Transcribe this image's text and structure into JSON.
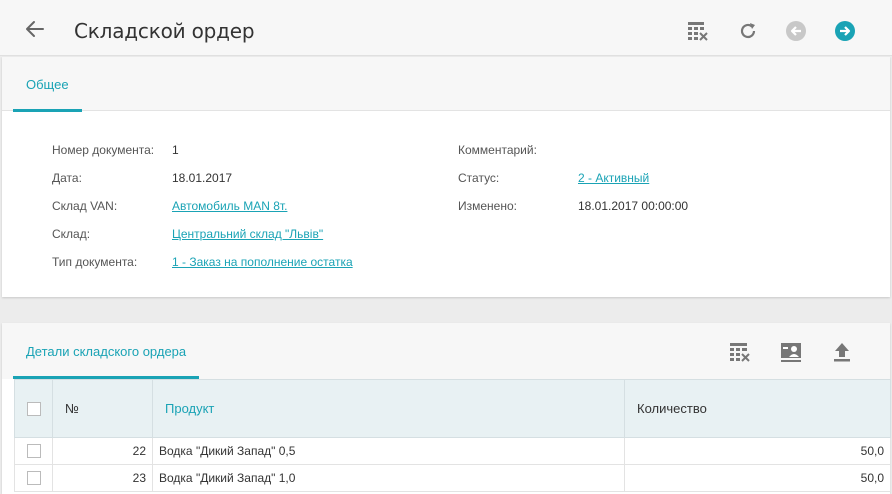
{
  "header": {
    "title": "Складской ордер"
  },
  "tabs": [
    {
      "label": "Общее"
    }
  ],
  "form": {
    "left": [
      {
        "label": "Номер документа:",
        "value": "1",
        "link": false
      },
      {
        "label": "Дата:",
        "value": "18.01.2017",
        "link": false
      },
      {
        "label": "Склад VAN:",
        "value": "Автомобиль MAN 8т.",
        "link": true
      },
      {
        "label": "Склад:",
        "value": "Центральний склад \"Львів\"",
        "link": true
      },
      {
        "label": "Тип документа:",
        "value": "1 - Заказ на пополнение остатка",
        "link": true
      }
    ],
    "right": [
      {
        "label": "Комментарий:",
        "value": "",
        "link": false
      },
      {
        "label": "Статус:",
        "value": "2 - Активный",
        "link": true
      },
      {
        "label": "Изменено:",
        "value": "18.01.2017 00:00:00",
        "link": false
      }
    ]
  },
  "details": {
    "tab_label": "Детали складского ордера",
    "columns": [
      "№",
      "Продукт",
      "Количество"
    ],
    "rows": [
      {
        "num": "22",
        "product": "Водка \"Дикий Запад\" 0,5",
        "qty": "50,0"
      },
      {
        "num": "23",
        "product": "Водка \"Дикий Запад\" 1,0",
        "qty": "50,0"
      }
    ]
  },
  "colors": {
    "accent": "#1aa3b5",
    "header_bg": "#f7f7f7",
    "grid_header_bg": "#e8f1f3"
  }
}
